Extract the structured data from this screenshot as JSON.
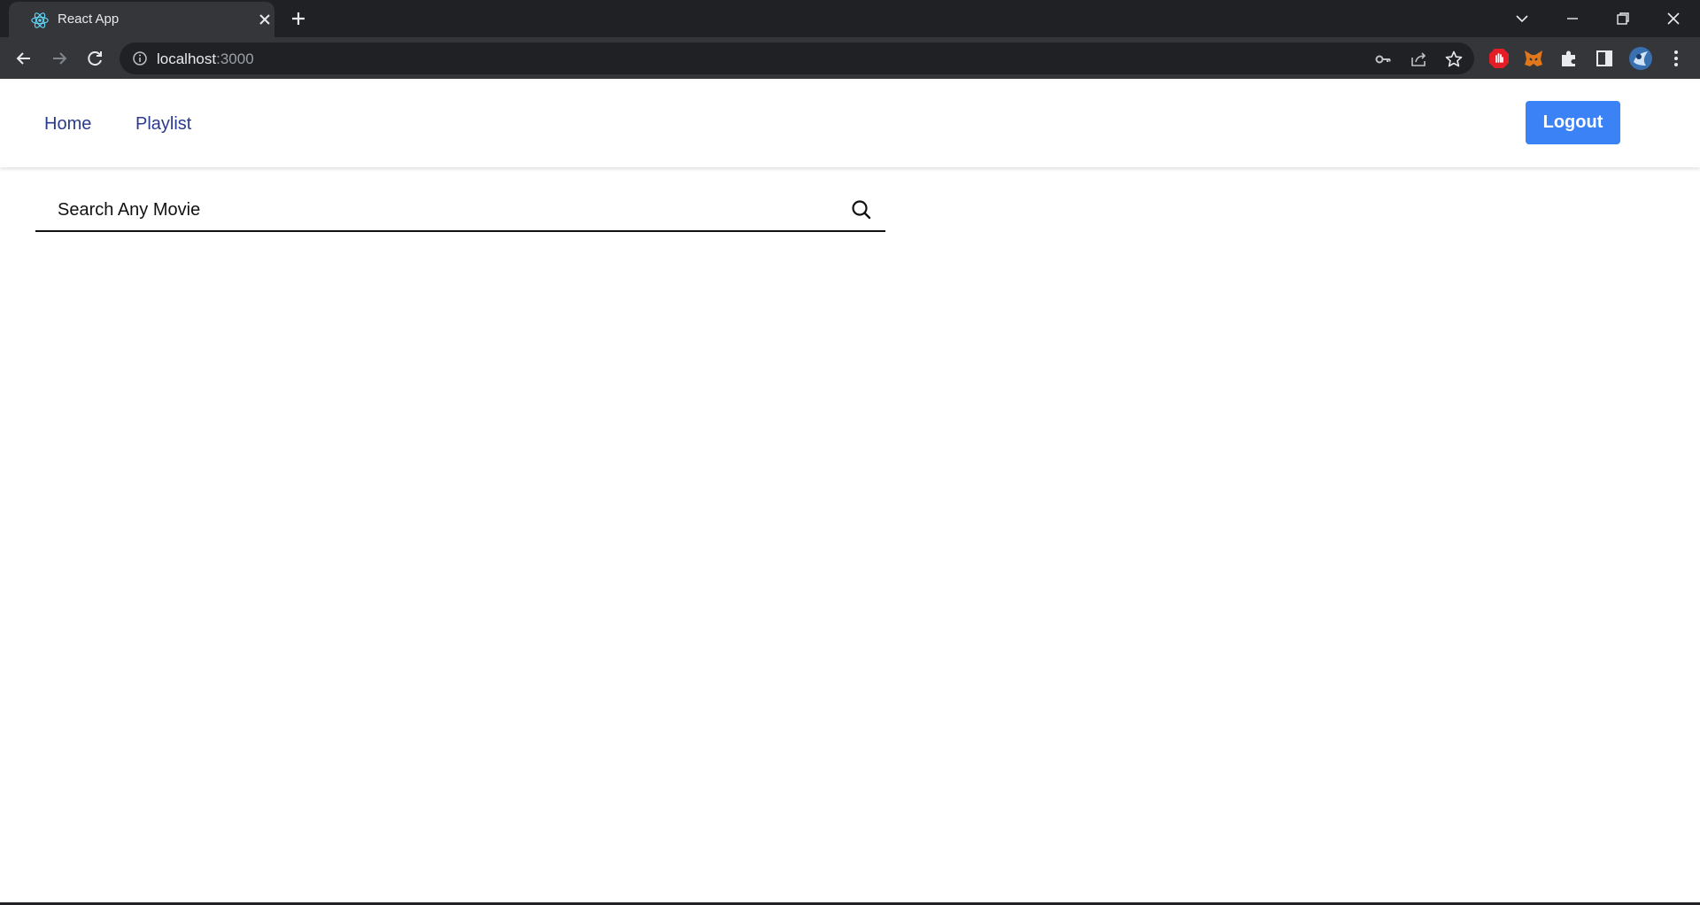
{
  "browser": {
    "tab_title": "React App",
    "url_host": "localhost",
    "url_port": ":3000",
    "icons": {
      "favicon": "react-logo-icon",
      "close": "close-icon",
      "new_tab": "plus-icon",
      "back": "arrow-left-icon",
      "forward": "arrow-right-icon",
      "reload": "reload-icon",
      "site_info": "info-icon",
      "key": "key-icon",
      "share": "share-icon",
      "bookmark": "star-icon",
      "extensions": "puzzle-icon",
      "side_panel": "side-panel-icon",
      "menu": "kebab-menu-icon"
    }
  },
  "navbar": {
    "links": [
      "Home",
      "Playlist"
    ],
    "logout_label": "Logout"
  },
  "search": {
    "placeholder": "Search Any Movie",
    "icon": "search-icon"
  },
  "colors": {
    "accent": "#3b82f6",
    "nav_link": "#2a3a8f",
    "chrome_dark": "#202124",
    "chrome_toolbar": "#35363a"
  }
}
